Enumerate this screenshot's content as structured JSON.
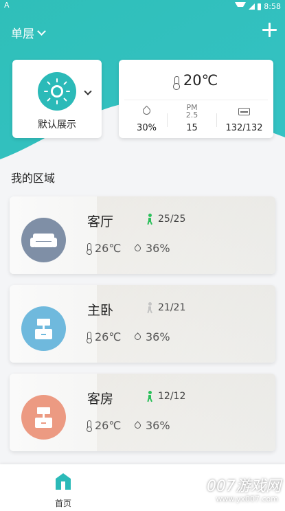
{
  "status_bar": {
    "left_glyph": "A",
    "time": "8:58"
  },
  "toolbar": {
    "floor_label": "单层",
    "add_icon": "plus-icon"
  },
  "scene": {
    "label": "默认展示",
    "icon": "sun-icon"
  },
  "environment": {
    "temperature": "20℃",
    "humidity": "30%",
    "pm_label_top": "PM",
    "pm_label_bottom": "2.5",
    "pm_value": "15",
    "devices": "132/132"
  },
  "section_title": "我的区域",
  "rooms": [
    {
      "name": "客厅",
      "count": "25/25",
      "temp": "26℃",
      "humidity": "36%",
      "color": "#7f8fa6",
      "person_color": "#2bbf5a",
      "icon": "sofa-icon"
    },
    {
      "name": "主卧",
      "count": "21/21",
      "temp": "26℃",
      "humidity": "36%",
      "color": "#6fb9dd",
      "person_color": "#c4c4c4",
      "icon": "bed-lamp-icon"
    },
    {
      "name": "客房",
      "count": "12/12",
      "temp": "26℃",
      "humidity": "36%",
      "color": "#ec9a82",
      "person_color": "#2bbf5a",
      "icon": "bed-lamp-icon"
    }
  ],
  "tabbar": {
    "home_label": "首页"
  },
  "watermark": {
    "main": "007游戏网",
    "sub": "www.yx007.com"
  },
  "colors": {
    "accent": "#2bbab8"
  }
}
